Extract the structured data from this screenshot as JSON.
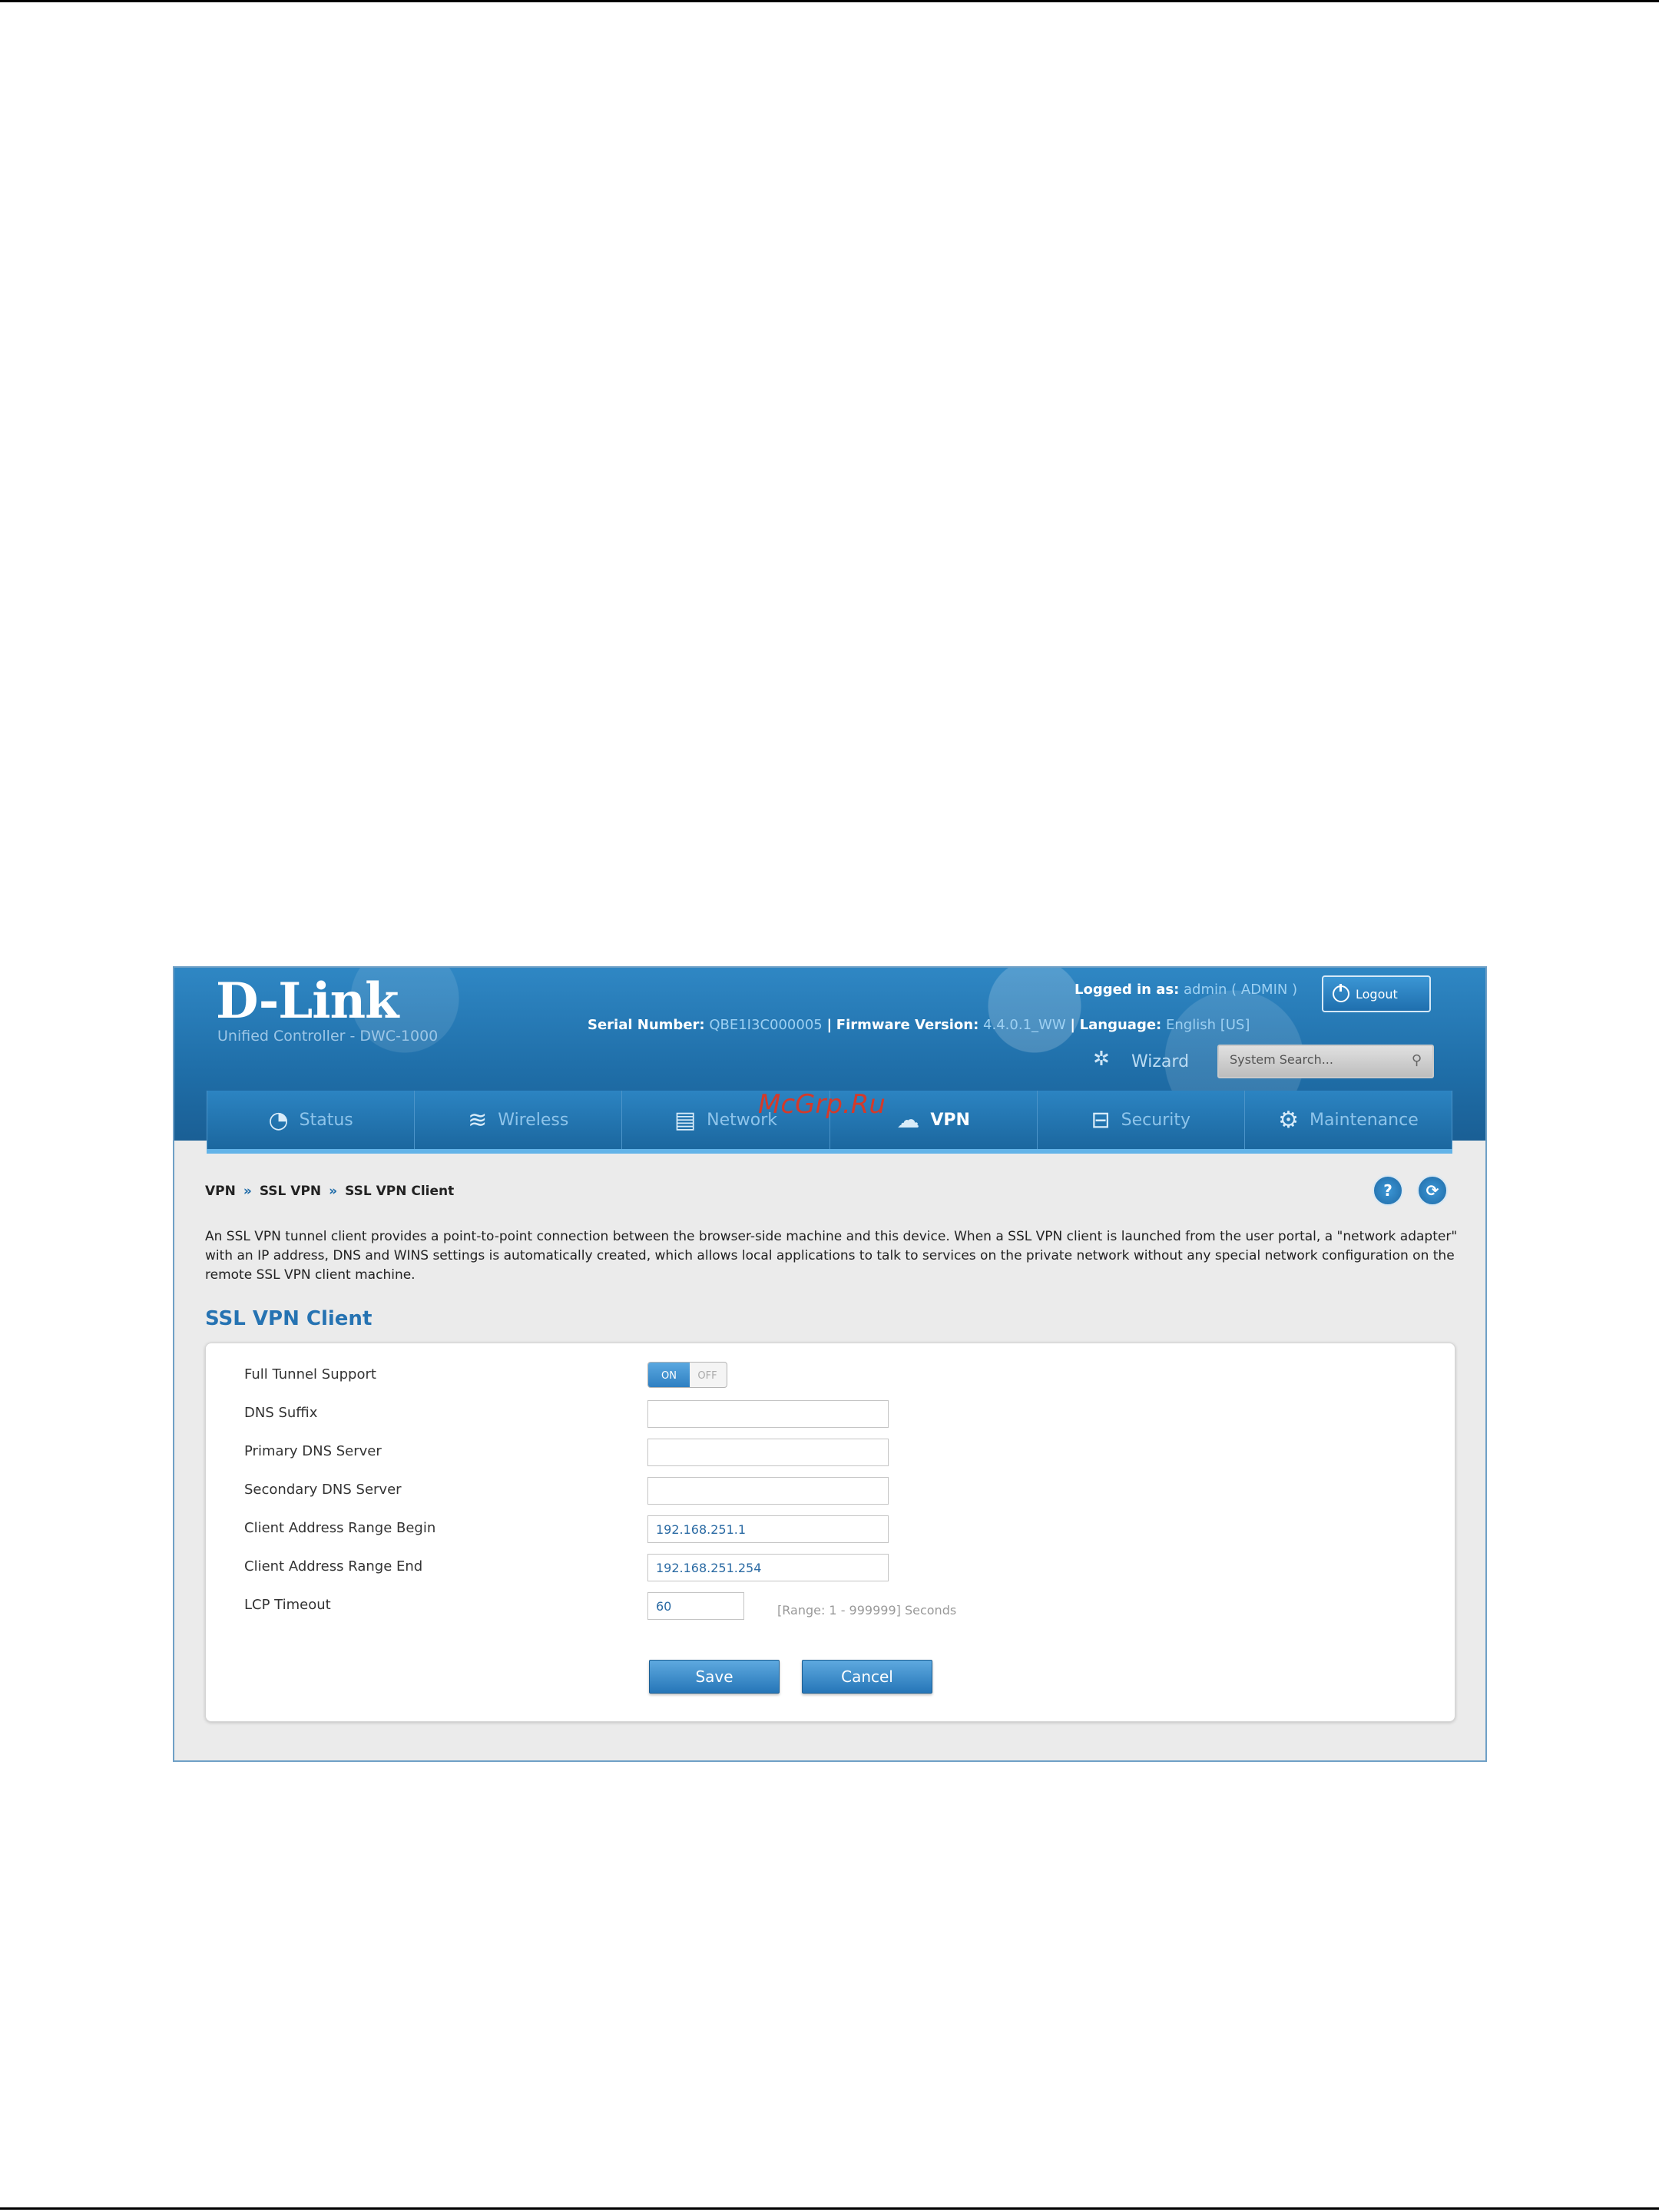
{
  "brand": {
    "logo": "D-Link",
    "tagline": "Unified Controller - DWC-1000"
  },
  "header": {
    "logged_in_label": "Logged in as:",
    "logged_in_user": "admin ( ADMIN )",
    "logout_label": "Logout",
    "serial_label": "Serial Number:",
    "serial_value": "QBE1I3C000005",
    "firmware_label": "Firmware Version:",
    "firmware_value": "4.4.0.1_WW",
    "language_label": "Language:",
    "language_value": "English [US]",
    "separator": "|",
    "wizard_label": "Wizard",
    "search_placeholder": "System Search..."
  },
  "nav": {
    "items": [
      {
        "label": "Status",
        "icon": "gauge-icon",
        "glyph": "◔"
      },
      {
        "label": "Wireless",
        "icon": "wifi-icon",
        "glyph": "≋"
      },
      {
        "label": "Network",
        "icon": "server-icon",
        "glyph": "▤"
      },
      {
        "label": "VPN",
        "icon": "cloud-lock-icon",
        "glyph": "☁"
      },
      {
        "label": "Security",
        "icon": "lock-icon",
        "glyph": "⊟"
      },
      {
        "label": "Maintenance",
        "icon": "gears-icon",
        "glyph": "⚙"
      }
    ],
    "active": "VPN"
  },
  "watermark": "McGrp.Ru",
  "breadcrumb": {
    "items": [
      "VPN",
      "SSL VPN",
      "SSL VPN Client"
    ],
    "separator": "»"
  },
  "description": "An SSL VPN tunnel client provides a point-to-point connection between the browser-side machine and this device. When a SSL VPN client is launched from the user portal, a \"network adapter\" with an IP address, DNS and WINS settings is automatically created, which allows local applications to talk to services on the private network without any special network configuration on the remote SSL VPN client machine.",
  "section_title": "SSL VPN Client",
  "form": {
    "full_tunnel": {
      "label": "Full Tunnel Support",
      "on": "ON",
      "off": "OFF",
      "value": true
    },
    "dns_suffix": {
      "label": "DNS Suffix",
      "value": ""
    },
    "primary_dns": {
      "label": "Primary DNS Server",
      "value": ""
    },
    "secondary_dns": {
      "label": "Secondary DNS Server",
      "value": ""
    },
    "range_begin": {
      "label": "Client Address Range Begin",
      "value": "192.168.251.1"
    },
    "range_end": {
      "label": "Client Address Range End",
      "value": "192.168.251.254"
    },
    "lcp_timeout": {
      "label": "LCP Timeout",
      "value": "60",
      "hint": "[Range: 1 - 999999] Seconds"
    },
    "save_label": "Save",
    "cancel_label": "Cancel"
  },
  "help_glyph": "?",
  "refresh_glyph": "⟳",
  "colors": {
    "header_blue": "#1f6ea8",
    "accent_blue": "#2673b2",
    "nav_highlight": "#62b3e8"
  }
}
